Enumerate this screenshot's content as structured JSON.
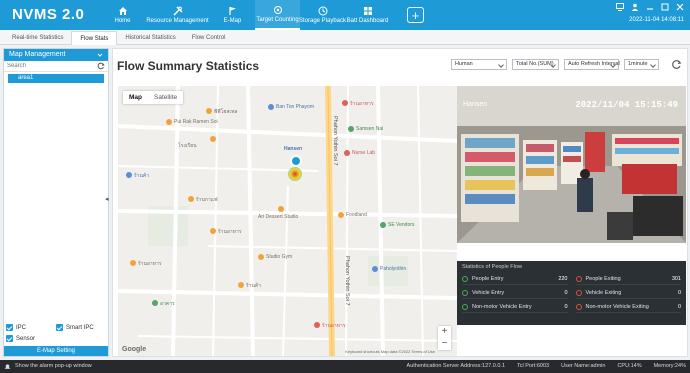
{
  "app": {
    "title": "NVMS 2.0",
    "datetime": "2022-11-04 14:08:11"
  },
  "colors": {
    "accent": "#1e9bd6",
    "status_bar": "#27292c"
  },
  "nav": [
    {
      "label": "Home",
      "icon": "home-icon"
    },
    {
      "label": "Resource Management",
      "icon": "tools-icon"
    },
    {
      "label": "E-Map",
      "icon": "flag-icon"
    },
    {
      "label": "Target Counting",
      "icon": "target-icon"
    },
    {
      "label": "Storage Playback",
      "icon": "clock-icon"
    },
    {
      "label": "Batt Dashboard",
      "icon": "grid-icon"
    }
  ],
  "tabs": [
    "Real-time Statistics",
    "Flow Stats",
    "Historical Statistics",
    "Flow Control"
  ],
  "left_panel": {
    "title": "Map Management",
    "search_placeholder": "Search",
    "tree_item": "area1",
    "checks": [
      "IPC",
      "Smart IPC",
      "Sensor"
    ],
    "emap_button": "E-Map Setting"
  },
  "main": {
    "title": "Flow Summary Statistics",
    "filters": [
      "Human",
      "Total No.(SUM)",
      "Auto Refresh Interval",
      "1minute"
    ]
  },
  "map": {
    "toggle": [
      "Map",
      "Satellite"
    ],
    "camera_label": "Hansen",
    "streets": [
      "Phahon Yothin Soi 7",
      "Phahon Yothin Soi 7"
    ],
    "labels": [
      "พีพีโฮสเทล",
      "Ban Ton Phayom",
      "ร้านอาหาร",
      "Pui Rak Ramen Soi",
      "โรงเรียน",
      "Samsen Nai",
      "Nurse Lab",
      "ร้านค้า",
      "Ari Dessert Studio",
      "ร้านกาแฟ",
      "Foodland",
      "SE Vendors",
      "ร้านอาหาร",
      "Studio Gym",
      "ร้านอาหาร",
      "Paholyothin",
      "ร้านค้า",
      "อาคาร",
      "ร้านอาหาร"
    ],
    "google": "Google",
    "footer": "Keyboard shortcuts  Map data ©2022  Terms of Use"
  },
  "video": {
    "label": "Hansen",
    "timestamp": "2022/11/04 15:15:49"
  },
  "stats": {
    "title": "Statistics of People Flow",
    "items": [
      {
        "label": "People Entry",
        "value": "220",
        "color": "green"
      },
      {
        "label": "People Exiting",
        "value": "301",
        "color": "red"
      },
      {
        "label": "Vehicle Entry",
        "value": "0",
        "color": "green"
      },
      {
        "label": "Vehicle Exiting",
        "value": "0",
        "color": "red"
      },
      {
        "label": "Non-motor Vehicle Entry",
        "value": "0",
        "color": "green"
      },
      {
        "label": "Non-motor Vehicle Exiting",
        "value": "0",
        "color": "red"
      }
    ]
  },
  "statusbar": {
    "left": "Show the alarm pop-up window",
    "right": [
      "Authentication Server Address:127.0.0.1",
      "Tcl Port:6003",
      "User Name:admin",
      "CPU:14%",
      "Memory:24%"
    ]
  }
}
